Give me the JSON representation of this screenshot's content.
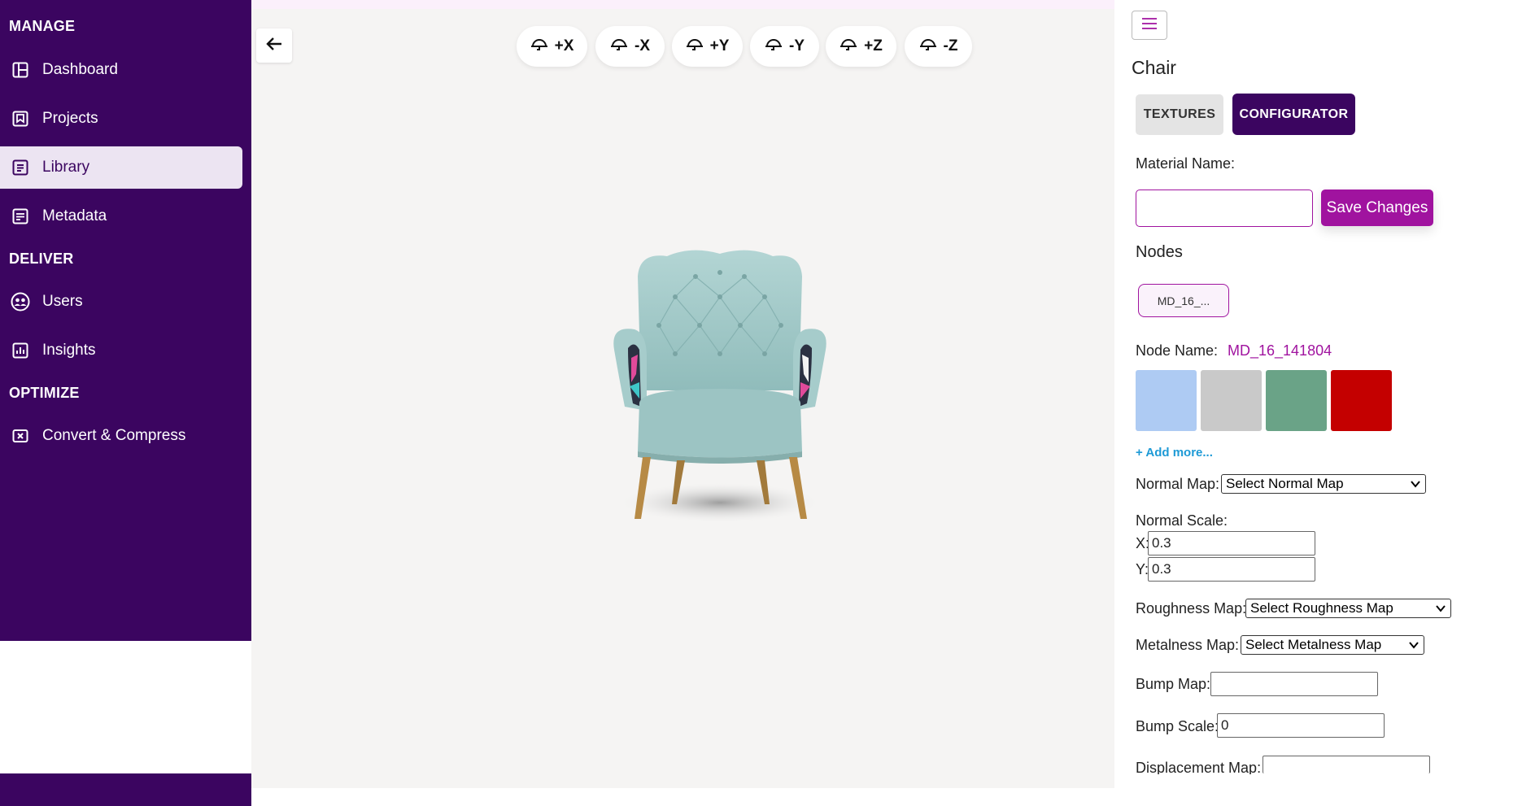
{
  "sidebar": {
    "sections": [
      "MANAGE",
      "DELIVER",
      "OPTIMIZE"
    ],
    "items": [
      {
        "label": "Dashboard",
        "icon": "dashboard-icon"
      },
      {
        "label": "Projects",
        "icon": "projects-icon"
      },
      {
        "label": "Library",
        "icon": "library-icon",
        "active": true
      },
      {
        "label": "Metadata",
        "icon": "metadata-icon"
      },
      {
        "label": "Users",
        "icon": "users-icon"
      },
      {
        "label": "Insights",
        "icon": "insights-icon"
      },
      {
        "label": "Convert & Compress",
        "icon": "convert-icon"
      }
    ]
  },
  "viewer": {
    "axis_buttons": [
      "+X",
      "-X",
      "+Y",
      "-Y",
      "+Z",
      "-Z"
    ]
  },
  "panel": {
    "title": "Chair",
    "tabs": {
      "textures": "TEXTURES",
      "configurator": "CONFIGURATOR"
    },
    "material_name_label": "Material Name:",
    "material_name_value": "",
    "save_label": "Save Changes",
    "nodes_label": "Nodes",
    "node_chip": "MD_16_...",
    "node_name_label": "Node Name:",
    "node_name_value": "MD_16_141804",
    "swatches": [
      "#aecbf3",
      "#c9c9c9",
      "#6aa387",
      "#c40000"
    ],
    "add_more": "+ Add more...",
    "normal_map_label": "Normal Map:",
    "normal_map_value": "Select Normal Map",
    "normal_scale_label": "Normal Scale:",
    "x_label": "X:",
    "x_value": "0.3",
    "y_label": "Y:",
    "y_value": "0.3",
    "roughness_label": "Roughness Map:",
    "roughness_value": "Select Roughness Map",
    "metalness_label": "Metalness Map:",
    "metalness_value": "Select Metalness Map",
    "bump_map_label": "Bump Map:",
    "bump_map_value": "",
    "bump_scale_label": "Bump Scale:",
    "bump_scale_value": "0",
    "displacement_label": "Displacement Map:",
    "displacement_value": ""
  },
  "colors": {
    "brand": "#3b0560",
    "accent": "#a0139f",
    "link": "#1e9ad6"
  }
}
